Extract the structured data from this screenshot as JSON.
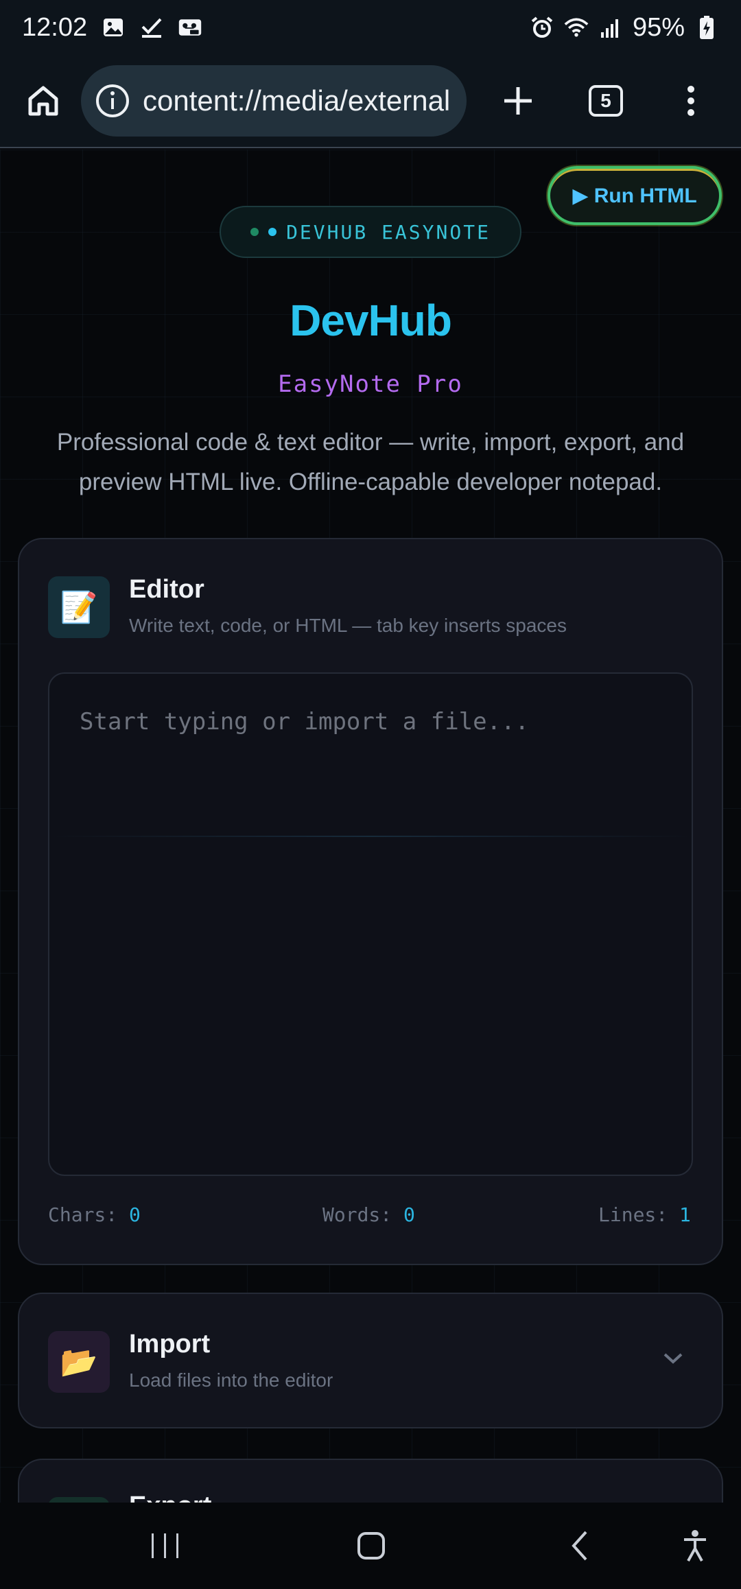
{
  "status_bar": {
    "time": "12:02",
    "battery": "95%",
    "left_icons": [
      "image-icon",
      "check-icon",
      "voicemail-icon"
    ],
    "right_icons": [
      "alarm-icon",
      "wifi-icon",
      "signal-icon",
      "battery-icon"
    ]
  },
  "browser": {
    "url": "content://media/external",
    "tab_count": "5"
  },
  "header": {
    "run_button": "▶ Run HTML",
    "badge": "DEVHUB EASYNOTE",
    "title": "DevHub",
    "subtitle": "EasyNote Pro",
    "description": "Professional code & text editor — write, import, export, and preview HTML live. Offline-capable developer notepad."
  },
  "editor": {
    "icon": "📝",
    "title": "Editor",
    "subtitle": "Write text, code, or HTML — tab key inserts spaces",
    "placeholder": "Start typing or import a file...",
    "stats": {
      "chars_label": "Chars:",
      "chars_value": "0",
      "words_label": "Words:",
      "words_value": "0",
      "lines_label": "Lines:",
      "lines_value": "1"
    }
  },
  "import_section": {
    "icon": "📂",
    "title": "Import",
    "subtitle": "Load files into the editor"
  },
  "export_section": {
    "title": "Export"
  },
  "colors": {
    "accent": "#2bc3ee",
    "subtitle_purple": "#b46bf0",
    "badge_teal": "#39c4d8",
    "run_border": "#3fbf6a"
  }
}
